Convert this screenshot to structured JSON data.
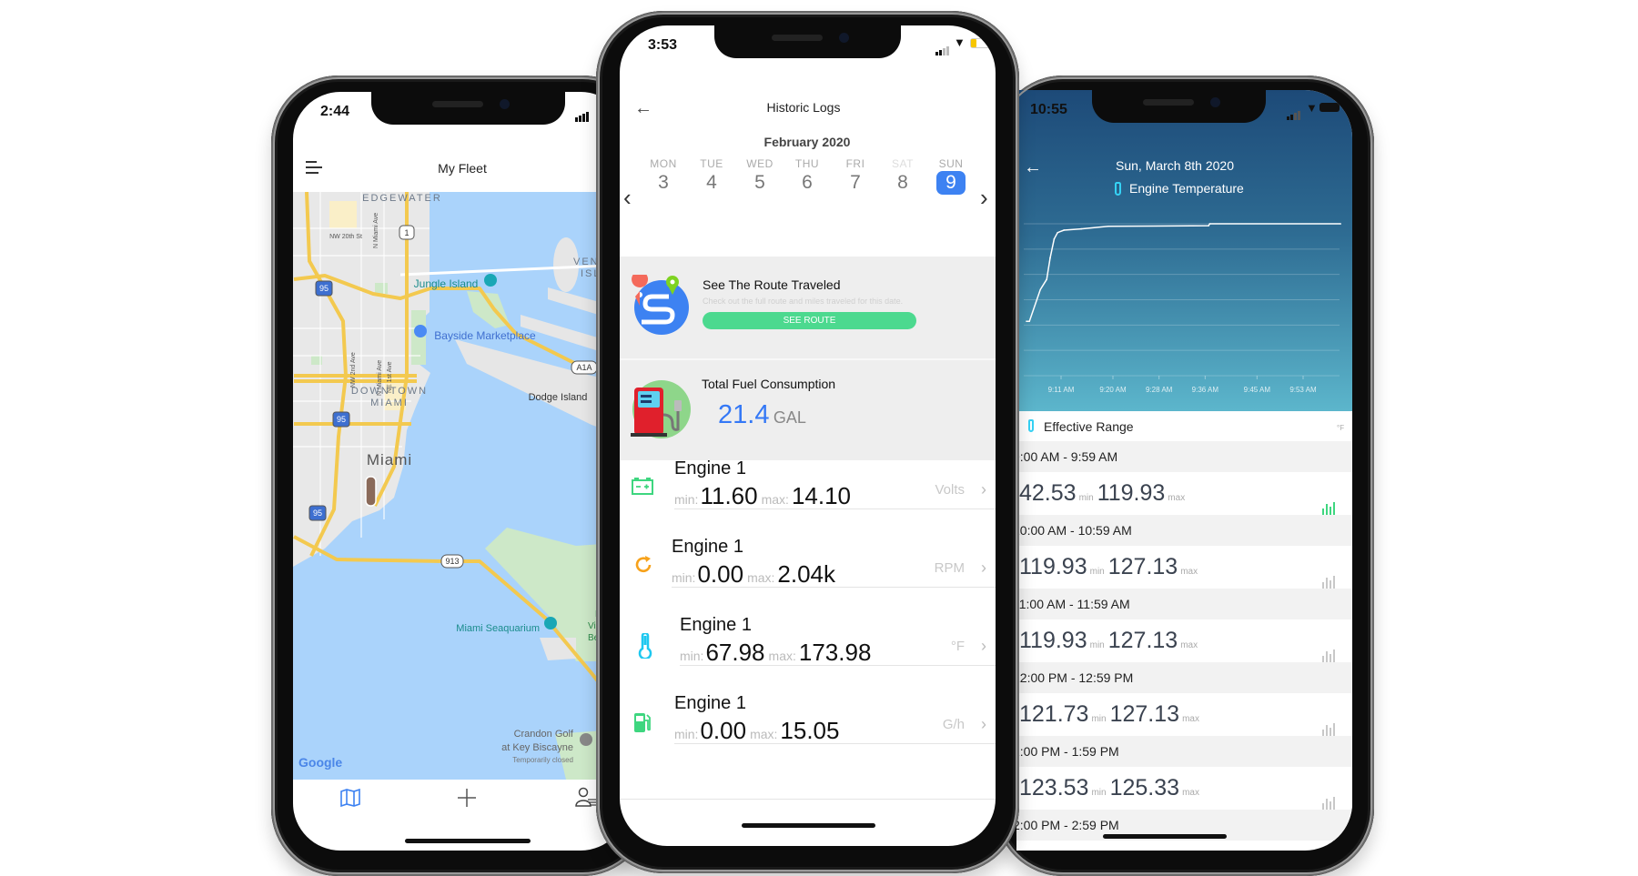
{
  "left_phone": {
    "status_time": "2:44",
    "header_title": "My Fleet",
    "map_labels": {
      "edgewater": "EDGEWATER",
      "nw_20th": "NW 20th St",
      "n_miami_ave": "N Miami Ave",
      "nw_2nd_ave": "NW 2nd Ave",
      "ne_1st_ave": "NE 1st Ave",
      "jungle_island": "Jungle Island",
      "bayside": "Bayside Marketplace",
      "downtown_1": "DOWNTOWN",
      "downtown_2": "MIAMI",
      "dodge_island": "Dodge Island",
      "miami": "Miami",
      "venetian_1": "VENET",
      "venetian_2": "ISLA",
      "seaquarium": "Miami Seaquarium",
      "crandon_1": "Crandon Golf",
      "crandon_2": "at Key Biscayne",
      "crandon_3": "Temporarily closed",
      "virginia_1": "H",
      "virginia_2": "Virg",
      "virginia_3": "Bea",
      "shield_95": "95",
      "shield_1": "1",
      "shield_913": "913",
      "shield_a1a": "A1A",
      "google": "Google"
    },
    "tabbar": {
      "icons": [
        "map-icon",
        "plus-icon",
        "user-list-icon"
      ],
      "active": "map-icon"
    },
    "colors": {
      "water": "#aad3fb",
      "land": "#e8e8e8",
      "road": "#f7d56a",
      "park": "#cde8c8",
      "active_tab": "#3d82f2"
    }
  },
  "middle_phone": {
    "status_time": "3:53",
    "title": "Historic Logs",
    "month": "February 2020",
    "days": [
      {
        "dow": "MON",
        "num": "3"
      },
      {
        "dow": "TUE",
        "num": "4"
      },
      {
        "dow": "WED",
        "num": "5"
      },
      {
        "dow": "THU",
        "num": "6"
      },
      {
        "dow": "FRI",
        "num": "7"
      },
      {
        "dow": "SAT",
        "num": "8"
      },
      {
        "dow": "SUN",
        "num": "9"
      }
    ],
    "selected_day": "9",
    "route_card": {
      "title": "See The Route Traveled",
      "subtitle": "Check out the full route and miles traveled for this date.",
      "button": "SEE ROUTE"
    },
    "fuel_card": {
      "title": "Total Fuel Consumption",
      "value": "21.4",
      "unit": "GAL"
    },
    "engine_rows": [
      {
        "icon": "battery-icon",
        "color": "#3ed67f",
        "name": "Engine 1",
        "min_label": "min:",
        "min": "11.60",
        "max_label": "max:",
        "max": "14.10",
        "unit": "Volts"
      },
      {
        "icon": "rpm-refresh-icon",
        "color": "#f7a21b",
        "name": "Engine 1",
        "min_label": "min:",
        "min": "0.00",
        "max_label": "max:",
        "max": "2.04k",
        "unit": "RPM"
      },
      {
        "icon": "thermometer-icon",
        "color": "#1ec8f0",
        "name": "Engine 1",
        "min_label": "min:",
        "min": "67.98",
        "max_label": "max:",
        "max": "173.98",
        "unit": "°F"
      },
      {
        "icon": "fuel-pump-icon",
        "color": "#3ed67f",
        "name": "Engine 1",
        "min_label": "min:",
        "min": "0.00",
        "max_label": "max:",
        "max": "15.05",
        "unit": "G/h"
      }
    ],
    "colors": {
      "accent": "#3d82f2",
      "button": "#4cd98f",
      "fuel_value": "#3478f6"
    }
  },
  "right_phone": {
    "status_time": "10:55",
    "date": "Sun, March 8th 2020",
    "metric": "Engine Temperature",
    "range_header": "Effective Range",
    "unit": "°F",
    "min_label": "min",
    "max_label": "max",
    "ranges": [
      {
        "period": "9:00 AM - 9:59 AM",
        "min": "42.53",
        "max": "119.93",
        "active": true
      },
      {
        "period": "10:00 AM - 10:59 AM",
        "min": "119.93",
        "max": "127.13",
        "active": false
      },
      {
        "period": "11:00 AM - 11:59 AM",
        "min": "119.93",
        "max": "127.13",
        "active": false
      },
      {
        "period": "12:00 PM - 12:59 PM",
        "min": "121.73",
        "max": "127.13",
        "active": false
      },
      {
        "period": "1:00 PM - 1:59 PM",
        "min": "123.53",
        "max": "125.33",
        "active": false
      },
      {
        "period": "2:00 PM - 2:59 PM"
      }
    ],
    "colors": {
      "gradient_top": "#1d4a78",
      "gradient_bottom": "#5cb6cc",
      "active_bar": "#3ed67f"
    }
  },
  "chart_data": {
    "type": "line",
    "title": "",
    "xlabel": "",
    "ylabel": "",
    "x_tick_labels": [
      "9:11 AM",
      "9:20 AM",
      "9:28 AM",
      "9:36 AM",
      "9:45 AM",
      "9:53 AM"
    ],
    "x_ticks_minutes_after_9am": [
      11,
      20,
      28,
      36,
      45,
      53
    ],
    "ylim": [
      0,
      120
    ],
    "grid": true,
    "points": [
      {
        "t": "9:05",
        "v": 43
      },
      {
        "t": "9:05:30",
        "v": 43
      },
      {
        "t": "9:07:24",
        "v": 68
      },
      {
        "t": "9:08:30",
        "v": 76
      },
      {
        "t": "9:09:06",
        "v": 93
      },
      {
        "t": "9:09:48",
        "v": 108
      },
      {
        "t": "9:10:24",
        "v": 113
      },
      {
        "t": "9:11:30",
        "v": 115
      },
      {
        "t": "9:14:30",
        "v": 116
      },
      {
        "t": "9:19:12",
        "v": 118
      },
      {
        "t": "9:36:36",
        "v": 118.5
      },
      {
        "t": "9:36:48",
        "v": 120
      },
      {
        "t": "9:59:30",
        "v": 120
      }
    ]
  }
}
